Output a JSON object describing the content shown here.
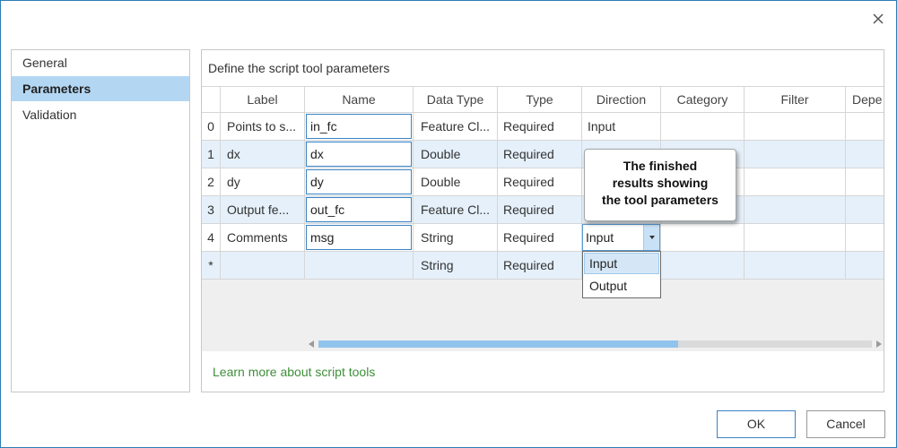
{
  "dialog": {
    "icons": {
      "close": "close-icon",
      "dropdown_arrow": "chevron-down-icon",
      "scroll_left": "scroll-left-arrow-icon",
      "scroll_right": "scroll-right-arrow-icon"
    }
  },
  "sidebar": {
    "items": [
      {
        "label": "General",
        "selected": false
      },
      {
        "label": "Parameters",
        "selected": true
      },
      {
        "label": "Validation",
        "selected": false
      }
    ]
  },
  "main": {
    "heading": "Define the script tool parameters",
    "table": {
      "columns": [
        "Label",
        "Name",
        "Data Type",
        "Type",
        "Direction",
        "Category",
        "Filter",
        "Depe"
      ],
      "rows": [
        {
          "index": "0",
          "label": "Points to s...",
          "name": "in_fc",
          "data_type": "Feature Cl...",
          "type": "Required",
          "direction": "Input"
        },
        {
          "index": "1",
          "label": "dx",
          "name": "dx",
          "data_type": "Double",
          "type": "Required"
        },
        {
          "index": "2",
          "label": "dy",
          "name": "dy",
          "data_type": "Double",
          "type": "Required"
        },
        {
          "index": "3",
          "label": "Output fe...",
          "name": "out_fc",
          "data_type": "Feature Cl...",
          "type": "Required"
        },
        {
          "index": "4",
          "label": "Comments",
          "name": "msg",
          "data_type": "String",
          "type": "Required",
          "direction": "Input"
        },
        {
          "index": "*",
          "data_type": "String",
          "type": "Required"
        }
      ]
    },
    "direction_dropdown": {
      "options": [
        "Input",
        "Output"
      ],
      "highlighted_index": 0
    },
    "callout": {
      "lines": [
        "The finished",
        "results showing",
        "the tool parameters"
      ]
    },
    "help_link": "Learn more about script tools"
  },
  "footer": {
    "ok_label": "OK",
    "cancel_label": "Cancel"
  },
  "colors": {
    "selection": "#b3d7f3",
    "alternate_row": "#e5f0fa",
    "accent": "#3a83c4",
    "link": "#3f8f3a"
  }
}
